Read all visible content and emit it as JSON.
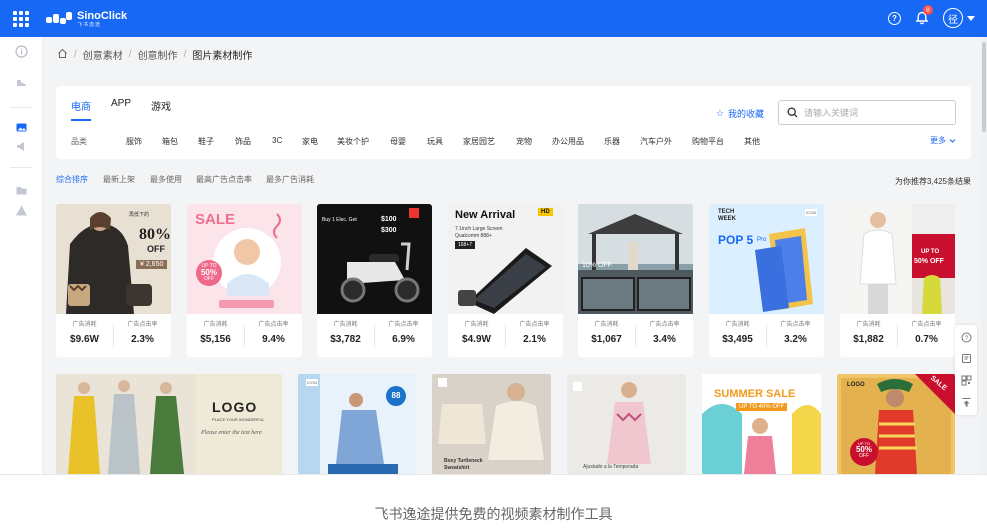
{
  "topbar": {
    "logo_name": "SinoClick",
    "logo_sub": "飞书逸途",
    "notification_count": "8",
    "avatar_text": "径",
    "brand_color": "#1769f5"
  },
  "breadcrumb": [
    "创意素材",
    "创意制作",
    "图片素材制作"
  ],
  "tabs": [
    {
      "label": "电商",
      "active": true
    },
    {
      "label": "APP",
      "active": false
    },
    {
      "label": "游戏",
      "active": false
    }
  ],
  "favorites_label": "我的收藏",
  "search": {
    "placeholder": "请输入关键词"
  },
  "category_label": "品类",
  "categories": [
    "服饰",
    "箱包",
    "鞋子",
    "饰品",
    "3C",
    "家电",
    "美妆个护",
    "母婴",
    "玩具",
    "家居园艺",
    "宠物",
    "办公用品",
    "乐器",
    "汽车户外",
    "购物平台",
    "其他"
  ],
  "more_label": "更多",
  "sort_options": [
    {
      "label": "综合排序",
      "active": true
    },
    {
      "label": "最新上架",
      "active": false
    },
    {
      "label": "最多使用",
      "active": false
    },
    {
      "label": "最高广告点击率",
      "active": false
    },
    {
      "label": "最多广告消耗",
      "active": false
    }
  ],
  "result_text": "为你推荐3,425条结果",
  "stat_labels": {
    "spend": "广告消耗",
    "ctr": "广告点击率"
  },
  "cards": [
    {
      "spend": "$9.6W",
      "ctr": "2.3%",
      "thumb_texts": [
        "再低下的",
        "80%",
        "OFF",
        "¥ 2,650"
      ]
    },
    {
      "spend": "$5,156",
      "ctr": "9.4%",
      "thumb_texts": [
        "SALE",
        "UP TO",
        "50%",
        "OFF"
      ]
    },
    {
      "spend": "$3,782",
      "ctr": "6.9%",
      "thumb_texts": [
        "Buy 1 Elec. Get",
        "$100",
        "$300"
      ]
    },
    {
      "spend": "$4.9W",
      "ctr": "2.1%",
      "thumb_texts": [
        "New Arrival",
        "HD",
        "7.1inch Large Screen",
        "Qualcomm 888+",
        "168+7"
      ]
    },
    {
      "spend": "$1,067",
      "ctr": "3.4%",
      "thumb_texts": [
        "10% OFF"
      ]
    },
    {
      "spend": "$3,495",
      "ctr": "3.2%",
      "thumb_texts": [
        "TECH",
        "WEEK",
        "POP 5",
        "Pro",
        "ICON"
      ]
    },
    {
      "spend": "$1,882",
      "ctr": "0.7%",
      "thumb_texts": [
        "UP TO",
        "50% OFF"
      ]
    }
  ],
  "row2": {
    "logo_banner": {
      "logo": "LOGO",
      "sub1": "PLACE YOUR WONDERFUL",
      "sub2": "Please enter the text here"
    },
    "card_b": {
      "tag": "ICON",
      "badge": "88"
    },
    "card_c": {
      "title1": "Boxy Turtleneck",
      "title2": "Sweatshirt"
    },
    "card_d": {
      "caption": "Ajustado a la Temporada"
    },
    "card_e": {
      "title": "SUMMER SALE",
      "sub": "UP TO 40% OFF"
    },
    "card_f": {
      "logo": "LOGO",
      "ribbon": "SALE",
      "pct": "50%",
      "off": "OFF",
      "upto": "UP TO"
    }
  },
  "caption": "飞书逸途提供免费的视频素材制作工具"
}
